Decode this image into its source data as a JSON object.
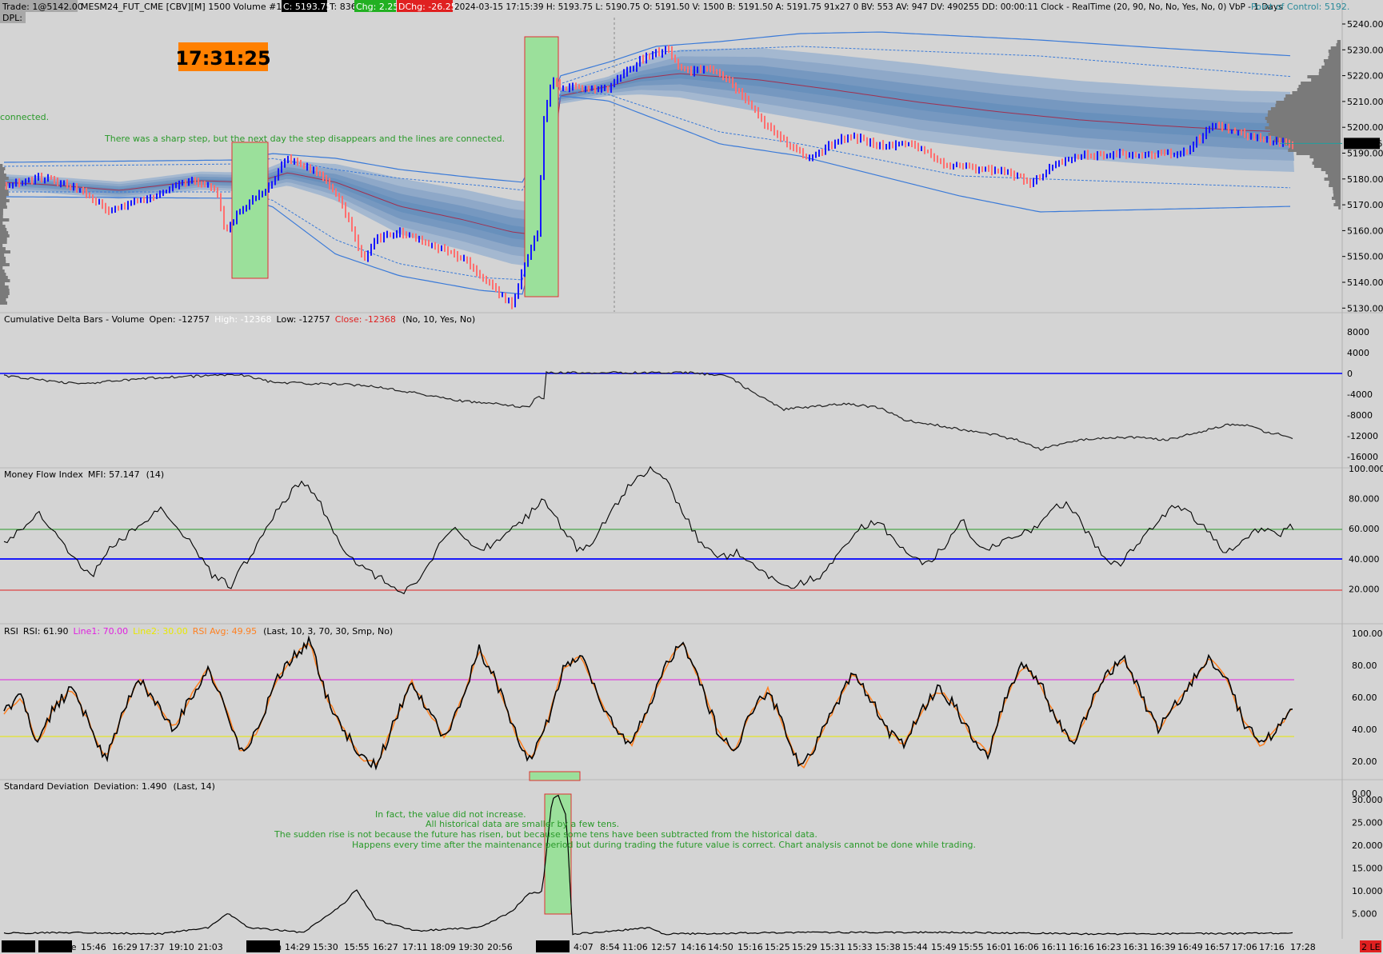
{
  "header": {
    "trade": "Trade: 1@5142.00",
    "symbol": "MESM24_FUT_CME [CBV][M]  1500 Volume #15",
    "close_badge": "C: 5193.75",
    "ticks": "T: 836",
    "chg_badge": "Chg: 2.25",
    "dchg_badge": "DChg: -26.25",
    "info": "2024-03-15 17:15:39 H: 5193.75 L: 5190.75 O: 5191.50 V: 1500 B: 5191.50 A: 5191.75 91x27 0 BV: 553 AV: 947 DV: 490255 DD: 00:00:11 Clock - RealTime  (20, 90, No, No, Yes, No, 0)  VbP - 1 Days",
    "poc": "Point of Control: 5192.",
    "dpl": "DPL:",
    "colors": {
      "close_bg": "#000000",
      "chg_bg": "#22b022",
      "dchg_bg": "#e02020",
      "poc": "#2a8a9a"
    }
  },
  "clock": {
    "time": "17:31:25",
    "bg": "#ff8000"
  },
  "annotations": {
    "connected": "connected.",
    "sharp_step": "There was a sharp step, but the next day the step disappears and the lines are connected.",
    "note1": "In fact, the value did not increase.",
    "note2": "All historical data are smaller by a few tens.",
    "note3": "The sudden rise is not because the future has risen, but because some tens have been subtracted from the historical data.",
    "note4": "Happens every time after the maintenance period but during trading the future value is correct. Chart analysis cannot be done while trading.",
    "color": "#2a9a2a"
  },
  "price_axis": {
    "ticks": [
      "5240.00",
      "5230.00",
      "5220.00",
      "5210.00",
      "5200.00",
      "5190.00",
      "5180.00",
      "5170.00",
      "5160.00",
      "5150.00",
      "5140.00",
      "5130.00"
    ],
    "current": "5193.75",
    "min": 5125,
    "max": 5243
  },
  "cd_panel": {
    "name": "Cumulative Delta Bars - Volume",
    "open": "Open: -12757",
    "high": "High: -12368",
    "low": "Low: -12757",
    "close": "Close: -12368",
    "params": "(No, 10, Yes, No)",
    "ticks": [
      "8000",
      "4000",
      "0",
      "-4000",
      "-8000",
      "-12000",
      "-16000"
    ]
  },
  "mfi_panel": {
    "name": "Money Flow Index",
    "value": "MFI: 57.147",
    "params": "(14)",
    "ticks": [
      "100.000",
      "80.000",
      "60.000",
      "40.000",
      "20.000"
    ]
  },
  "rsi_panel": {
    "name": "RSI",
    "value": "RSI: 61.90",
    "line1": "Line1: 70.00",
    "line2": "Line2: 30.00",
    "avg": "RSI Avg: 49.95",
    "params": "(Last, 10, 3, 70, 30, Smp, No)",
    "ticks": [
      "100.00",
      "80.00",
      "60.00",
      "40.00",
      "20.00",
      "0.00"
    ]
  },
  "sd_panel": {
    "name": "Standard Deviation",
    "value": "Deviation: 1.490",
    "params": "(Last, 14)",
    "ticks": [
      "30.000",
      "25.000",
      "20.000",
      "15.000",
      "10.000",
      "5.000"
    ]
  },
  "time_axis": {
    "dates": [
      "3-12 Tu",
      "3-13 We",
      "3-14 Th",
      "3-15 Fr"
    ],
    "times": [
      "15:46",
      "16:29",
      "17:37",
      "19:10",
      "21:03",
      "14:29",
      "15:30",
      "15:55",
      "16:27",
      "17:11",
      "18:09",
      "19:30",
      "20:56",
      "4:07",
      "8:54",
      "11:06",
      "12:57",
      "14:16",
      "14:50",
      "15:16",
      "15:25",
      "15:29",
      "15:31",
      "15:33",
      "15:38",
      "15:44",
      "15:49",
      "15:55",
      "16:01",
      "16:06",
      "16:11",
      "16:16",
      "16:23",
      "16:31",
      "16:39",
      "16:49",
      "16:57",
      "17:06",
      "17:16",
      "17:28"
    ],
    "end_badge": "2 LE"
  }
}
